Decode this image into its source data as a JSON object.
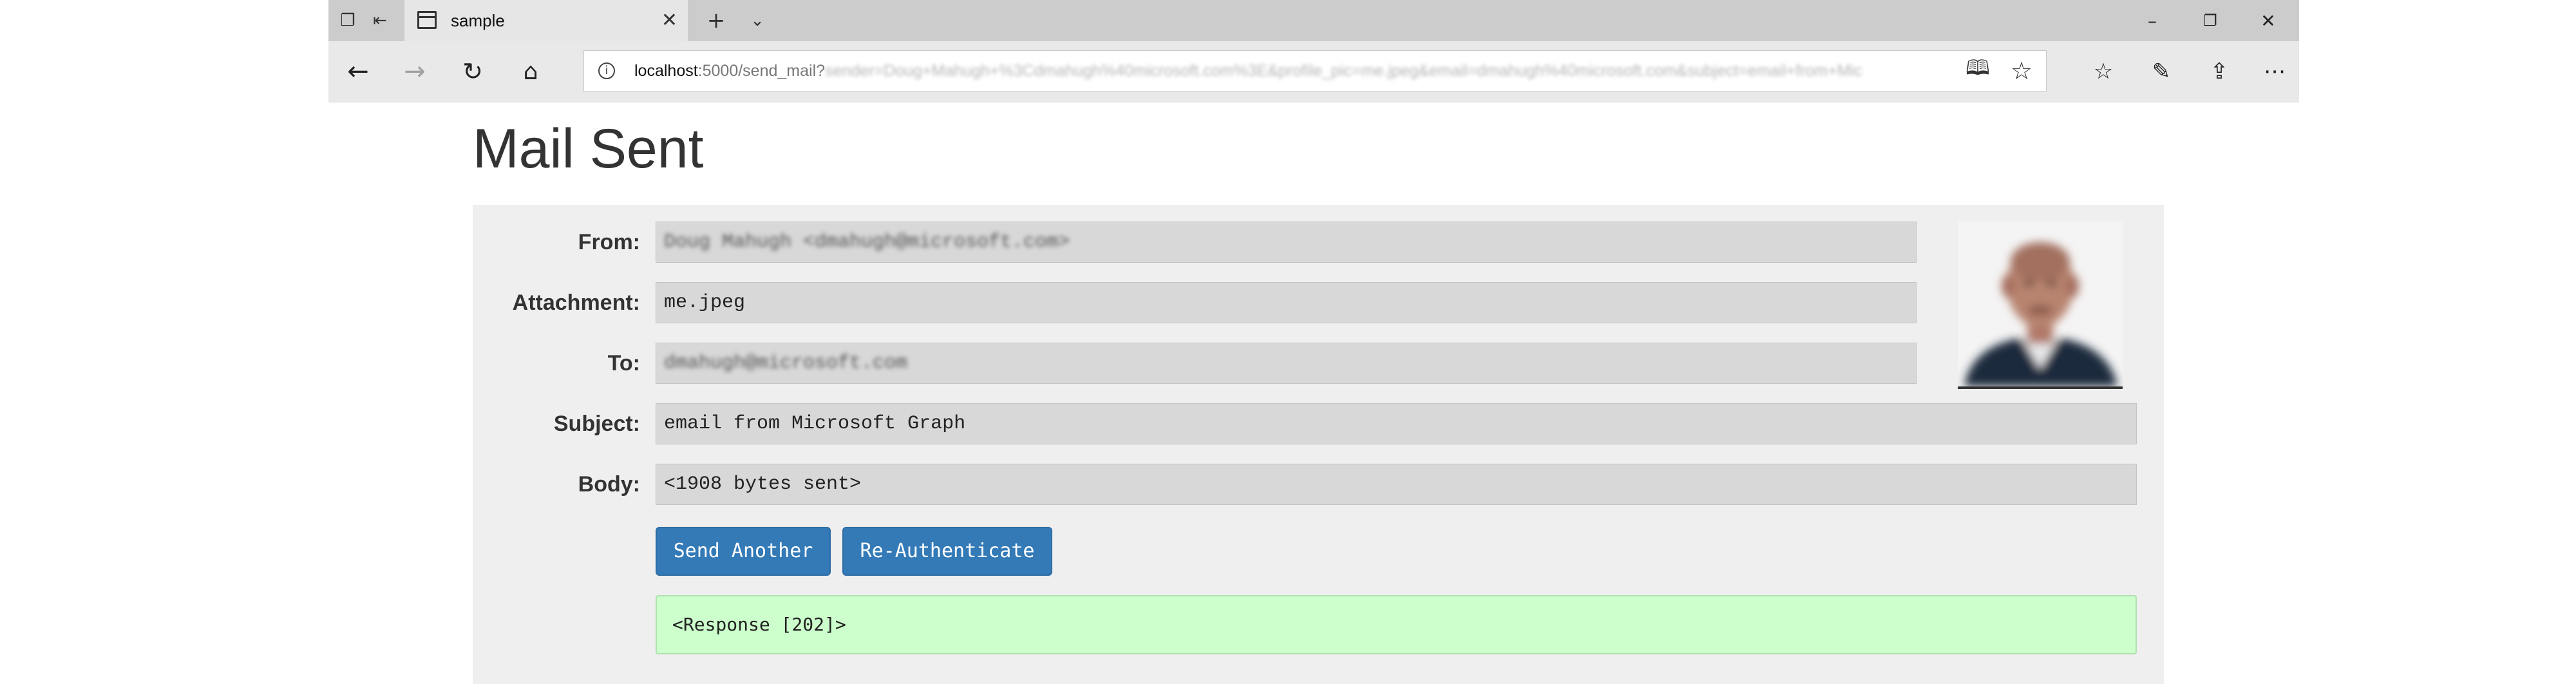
{
  "browser": {
    "tab_title": "sample",
    "url_host": "localhost",
    "url_path": ":5000/send_mail?",
    "url_query": "sender=Doug+Mahugh+%3Cdmahugh%40microsoft.com%3E&profile_pic=me.jpeg&email=dmahugh%40microsoft.com&subject=email+from+Mic"
  },
  "page": {
    "title": "Mail Sent"
  },
  "form": {
    "from_label": "From:",
    "from_value": "Doug Mahugh <dmahugh@microsoft.com>",
    "attachment_label": "Attachment:",
    "attachment_value": "me.jpeg",
    "to_label": "To:",
    "to_value": "dmahugh@microsoft.com",
    "subject_label": "Subject:",
    "subject_value": "email from Microsoft Graph",
    "body_label": "Body:",
    "body_value": "<1908 bytes sent>"
  },
  "actions": {
    "send_another": "Send Another",
    "reauthenticate": "Re-Authenticate"
  },
  "response": {
    "text": "<Response [202]>"
  },
  "colors": {
    "button_bg": "#337ab7",
    "response_bg": "#ccffcc",
    "panel_bg": "#efefef",
    "field_bg": "#d8d8d8"
  }
}
